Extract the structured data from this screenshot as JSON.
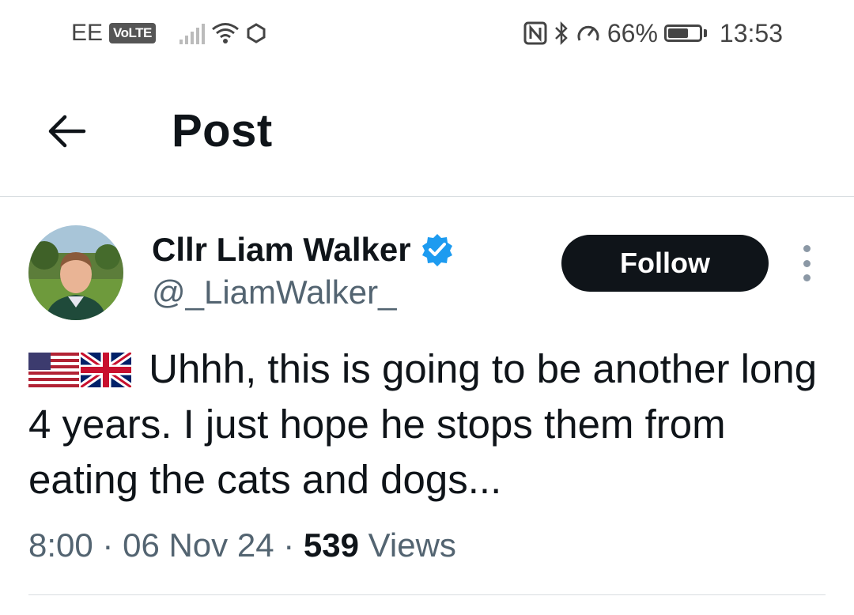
{
  "status_bar": {
    "carrier": "EE",
    "volte": "VoLTE",
    "battery_percent": "66%",
    "battery_level": 0.66,
    "time": "13:53"
  },
  "header": {
    "title": "Post"
  },
  "post": {
    "author_name": "Cllr Liam Walker",
    "author_handle": "@_LiamWalker_",
    "follow_label": "Follow",
    "text": "Uhhh, this is going to be another long 4 years. I just hope he stops them from eating the cats and dogs...",
    "time": "8:00",
    "date": "06 Nov 24",
    "views_count": "539",
    "views_label": "Views",
    "separator": "·"
  },
  "colors": {
    "text_primary": "#0f1419",
    "text_secondary": "#536471",
    "verified_blue": "#1d9bf0",
    "follow_bg": "#0f1419"
  }
}
